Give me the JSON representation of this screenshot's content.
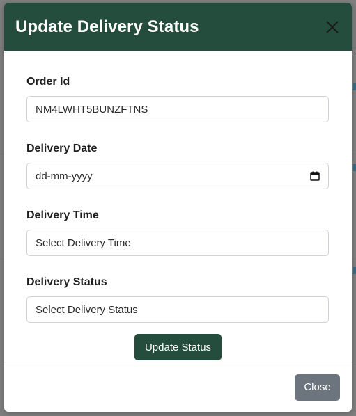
{
  "modal": {
    "title": "Update Delivery Status",
    "close_icon": "close-icon"
  },
  "form": {
    "order_id": {
      "label": "Order Id",
      "value": "NM4LWHT5BUNZFTNS"
    },
    "delivery_date": {
      "label": "Delivery Date",
      "value": "dd-mm-yyyy",
      "icon": "calendar-icon"
    },
    "delivery_time": {
      "label": "Delivery Time",
      "value": "Select Delivery Time"
    },
    "delivery_status": {
      "label": "Delivery Status",
      "value": "Select Delivery Status"
    },
    "submit_label": "Update Status"
  },
  "footer": {
    "close_label": "Close"
  },
  "colors": {
    "header_bg": "#254d3e",
    "primary_button": "#254d3e",
    "secondary_button": "#6c757d",
    "overlay": "#808080"
  }
}
